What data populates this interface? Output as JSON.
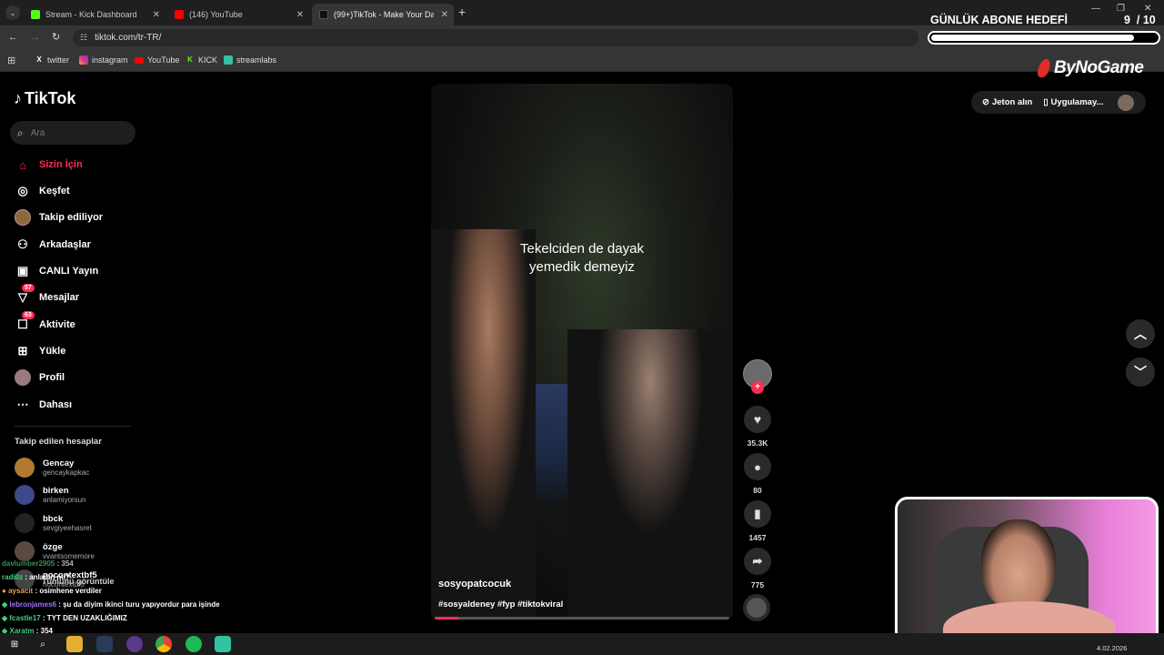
{
  "browser": {
    "tabs": [
      {
        "label": "Stream - Kick Dashboard",
        "color": "#53fc18"
      },
      {
        "label": "(146) YouTube",
        "color": "#ff0000"
      },
      {
        "label": "(99+)TikTok - Make Your Da",
        "color": "#111111"
      }
    ],
    "url": "tiktok.com/tr-TR/",
    "bookmarks": [
      "twitter",
      "instagram",
      "YouTube",
      "KICK",
      "streamlabs"
    ]
  },
  "overlay": {
    "goal_title": "GÜNLÜK ABONE HEDEFİ",
    "goal_count": "9",
    "goal_total": "/ 10",
    "goal_fraction": 0.9,
    "brand": "ByNoGame"
  },
  "tiktok": {
    "logo": "TikTok",
    "search_placeholder": "Ara",
    "nav": [
      {
        "label": "Sizin İçin",
        "icon": "home-icon",
        "active": true
      },
      {
        "label": "Keşfet",
        "icon": "compass-icon"
      },
      {
        "label": "Takip ediliyor",
        "icon": "following-avatar-icon"
      },
      {
        "label": "Arkadaşlar",
        "icon": "friends-icon"
      },
      {
        "label": "CANLI Yayın",
        "icon": "live-icon"
      },
      {
        "label": "Mesajlar",
        "icon": "message-icon",
        "badge": "57"
      },
      {
        "label": "Aktivite",
        "icon": "activity-icon",
        "badge": "63"
      },
      {
        "label": "Yükle",
        "icon": "upload-icon"
      },
      {
        "label": "Profil",
        "icon": "profile-avatar-icon"
      },
      {
        "label": "Dahası",
        "icon": "more-icon"
      }
    ],
    "following_title": "Takip edilen hesaplar",
    "following": [
      {
        "name": "Gencay",
        "handle": "gencaykapkac"
      },
      {
        "name": "birken",
        "handle": "anlamiyorsun"
      },
      {
        "name": "bbck",
        "handle": "sevgiyeehasret"
      },
      {
        "name": "özge",
        "handle": "vvantsomemore"
      },
      {
        "name": "nocontextbf5",
        "handle": "nocontextbf5"
      }
    ],
    "show_all": "Tümünü görüntüle",
    "header_buttons": {
      "coins": "Jeton alın",
      "app": "Uygulamay..."
    },
    "video": {
      "caption_line1": "Tekelciden de dayak",
      "caption_line2": "yemedik demeyiz",
      "username": "sosyopatcocuk",
      "tags": "#sosyaldeney #fyp #tiktokviral",
      "progress": 0.08
    },
    "actions": {
      "likes": "35.3K",
      "comments": "80",
      "saves": "1457",
      "shares": "775"
    }
  },
  "chat": [
    {
      "user": "davlumber2905",
      "msg": ": 354",
      "color": "#3fd17a"
    },
    {
      "user": "radi0z",
      "msg": ": anladın mı?",
      "color": "#3fd17a"
    },
    {
      "user": "aysacit",
      "msg": ": osimhene verdiler",
      "color": "#f0a040"
    },
    {
      "user": "lebronjames6",
      "msg": ": şu da diyim ikinci turu yapıyordur para işinde",
      "color": "#a070ff"
    },
    {
      "user": "fcastle17",
      "msg": ": TYT DEN UZAKLIĞIMIZ",
      "color": "#3fd17a"
    },
    {
      "user": "Xaratm",
      "msg": ": 354",
      "color": "#3fd17a"
    }
  ],
  "taskbar": {
    "date": "4.02.2026"
  }
}
